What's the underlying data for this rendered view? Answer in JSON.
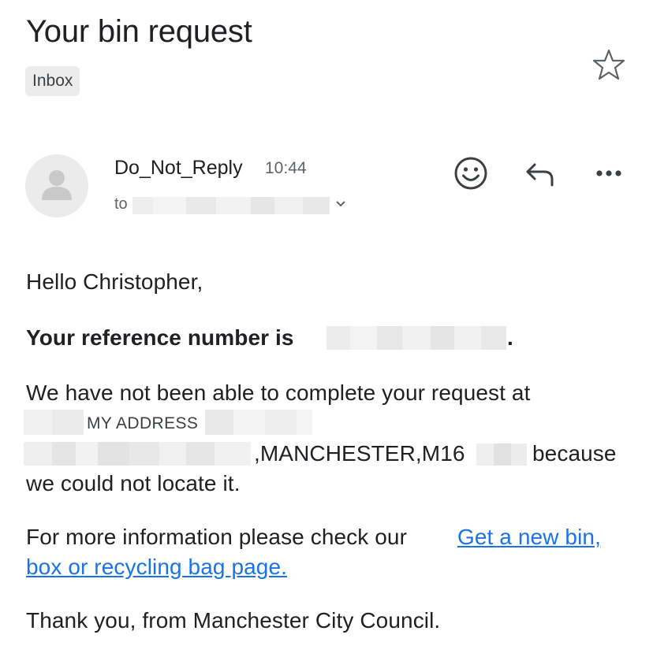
{
  "email": {
    "subject": "Your bin request",
    "label": "Inbox",
    "sender": "Do_Not_Reply",
    "time": "10:44",
    "to_prefix": "to"
  },
  "icons": {
    "star": "star-outline-icon",
    "avatar": "person-avatar-icon",
    "expand": "chevron-down-icon",
    "emoji": "smiley-icon",
    "reply": "reply-arrow-icon",
    "more": "more-horizontal-icon"
  },
  "body": {
    "greeting": "Hello Christopher,",
    "reference_text": "Your reference number is",
    "reference_end": ".",
    "request_line": "We have not been able to complete your request at",
    "address_label": "MY ADDRESS",
    "address_city": ",MANCHESTER,M16",
    "because": "because",
    "could_not_locate": "we could not locate it.",
    "info_text": "For more information please check our",
    "link_line1": "Get a new bin,",
    "link_line2": "box or recycling bag page.",
    "sign_off": "Thank you, from Manchester City Council."
  },
  "colors": {
    "link": "#1a73e8",
    "text": "#202124",
    "muted": "#5f6368",
    "chip_bg": "#ececec"
  }
}
